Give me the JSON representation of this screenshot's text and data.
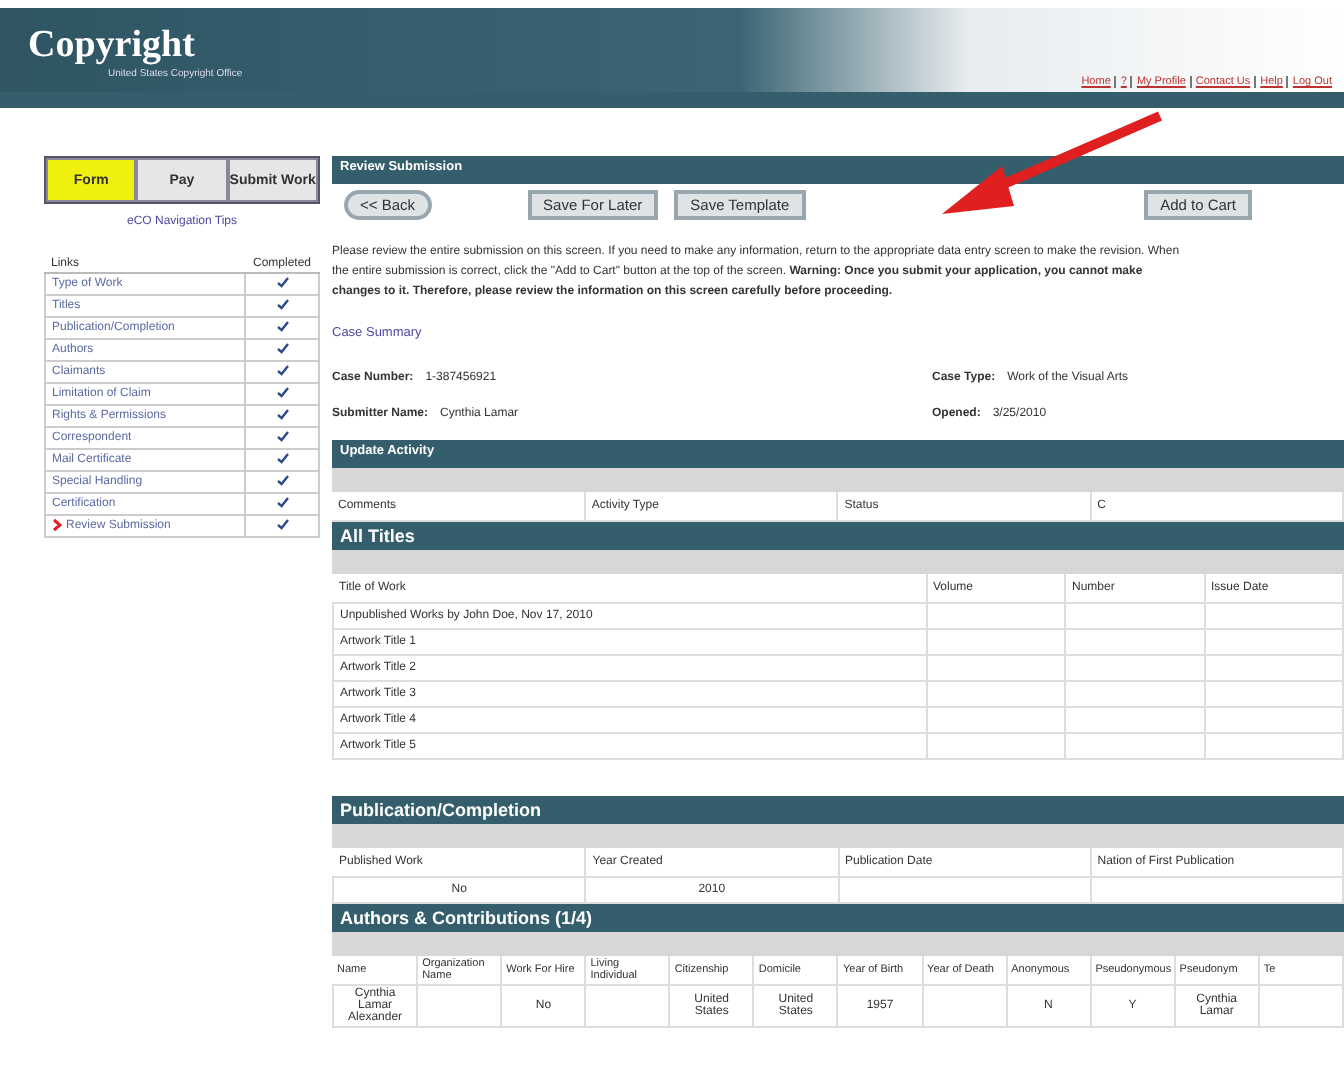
{
  "header": {
    "logo": "Copyright",
    "tagline": "United States Copyright Office",
    "links": [
      "Home",
      "?",
      "My Profile",
      "Contact Us",
      "Help",
      "Log Out"
    ]
  },
  "sidebar": {
    "tabs": [
      {
        "label": "Form",
        "selected": true
      },
      {
        "label": "Pay",
        "selected": false
      },
      {
        "label": "Submit Work",
        "selected": false
      }
    ],
    "tips_link": "eCO Navigation Tips",
    "columns": [
      "Links",
      "Completed"
    ],
    "items": [
      {
        "label": "Type of Work",
        "completed": true,
        "selected": false
      },
      {
        "label": "Titles",
        "completed": true,
        "selected": false
      },
      {
        "label": "Publication/Completion",
        "completed": true,
        "selected": false
      },
      {
        "label": "Authors",
        "completed": true,
        "selected": false
      },
      {
        "label": "Claimants",
        "completed": true,
        "selected": false
      },
      {
        "label": "Limitation of Claim",
        "completed": true,
        "selected": false
      },
      {
        "label": "Rights & Permissions",
        "completed": true,
        "selected": false
      },
      {
        "label": "Correspondent",
        "completed": true,
        "selected": false
      },
      {
        "label": "Mail Certificate",
        "completed": true,
        "selected": false
      },
      {
        "label": "Special Handling",
        "completed": true,
        "selected": false
      },
      {
        "label": "Certification",
        "completed": true,
        "selected": false
      },
      {
        "label": "Review Submission",
        "completed": true,
        "selected": true
      }
    ]
  },
  "main": {
    "title": "Review Submission",
    "buttons": [
      "<< Back",
      "Save For Later",
      "Save Template",
      "Add to Cart"
    ],
    "instructions": "Please review the entire submission on this screen. If you need to make any information, return to the appropriate data entry screen to make the revision. When the entire submission is correct, click the \"Add to Cart\" button at the top of the screen. **Warning: Once you submit your application, you cannot make changes to it. Therefore, please review the information on this screen carefully before proceeding.**",
    "case_summary": {
      "title": "Case Summary",
      "fields": [
        {
          "label": "Case Number:",
          "value": "1-387456921"
        },
        {
          "label": "Case Type:",
          "value": "Work of the Visual Arts"
        },
        {
          "label": "Submitter Name:",
          "value": "Cynthia Lamar"
        },
        {
          "label": "Opened:",
          "value": "3/25/2010"
        }
      ]
    },
    "update_activity": {
      "title": "Update Activity",
      "columns": [
        "Comments",
        "Activity Type",
        "Status",
        "C"
      ]
    },
    "all_titles": {
      "title": "All Titles",
      "columns": [
        "Title of Work",
        "Volume",
        "Number",
        "Issue Date"
      ],
      "rows": [
        "Unpublished Works by John Doe, Nov 17, 2010",
        "Artwork Title 1",
        "Artwork Title 2",
        "Artwork Title 3",
        "Artwork Title 4",
        "Artwork Title 5"
      ]
    },
    "publication": {
      "title": "Publication/Completion",
      "columns": [
        "Published Work",
        "Year Created",
        "Publication Date",
        "Nation of First Publication"
      ],
      "values": [
        "No",
        "2010"
      ]
    },
    "authors": {
      "title": "Authors & Contributions (1/4)",
      "columns": [
        "Name",
        "Organization Name",
        "Work For Hire",
        "Living Individual",
        "Citizenship",
        "Domicile",
        "Year of Birth",
        "Year of Death",
        "Anonymous",
        "Pseudonymous",
        "Pseudonym",
        "Te"
      ],
      "rows": [
        [
          "Cynthia Lamar Alexander",
          "",
          "No",
          "",
          "United States",
          "United States",
          "1957",
          "",
          "N",
          "Y",
          "Cynthia Lamar",
          ""
        ]
      ]
    }
  }
}
